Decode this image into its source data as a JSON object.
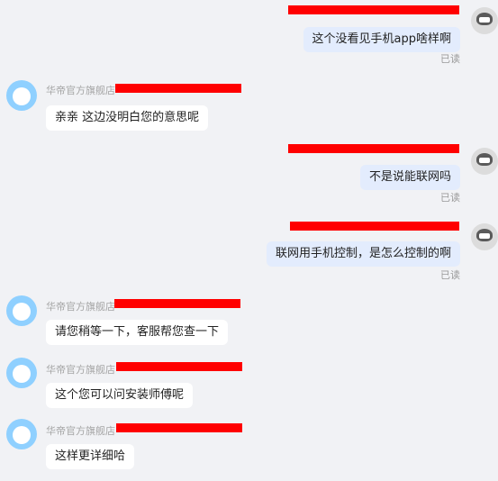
{
  "messages": [
    {
      "type": "out",
      "text": "这个没看见手机app啥样啊",
      "status": "已读"
    },
    {
      "type": "in",
      "sender": "华帝官方旗舰店",
      "text": "亲亲  这边没明白您的意思呢"
    },
    {
      "type": "out",
      "text": "不是说能联网吗",
      "status": "已读"
    },
    {
      "type": "out",
      "text": "联网用手机控制，是怎么控制的啊",
      "status": "已读"
    },
    {
      "type": "in",
      "sender": "华帝官方旗舰店",
      "text": "请您稍等一下，客服帮您查一下"
    },
    {
      "type": "in",
      "sender": "华帝官方旗舰店",
      "text": "这个您可以问安装师傅呢"
    },
    {
      "type": "in",
      "sender": "华帝官方旗舰店",
      "text": "这样更详细哈"
    }
  ],
  "colors": {
    "background": "#f1f2f5",
    "outgoing_bubble": "#e3ecfd",
    "incoming_bubble": "#ffffff",
    "redaction": "#ff0000",
    "shop_avatar": "#8fd0ff"
  },
  "icons": {
    "shop_avatar": "chat-bubble-avatar-icon",
    "user_avatar": "user-avatar-icon"
  }
}
